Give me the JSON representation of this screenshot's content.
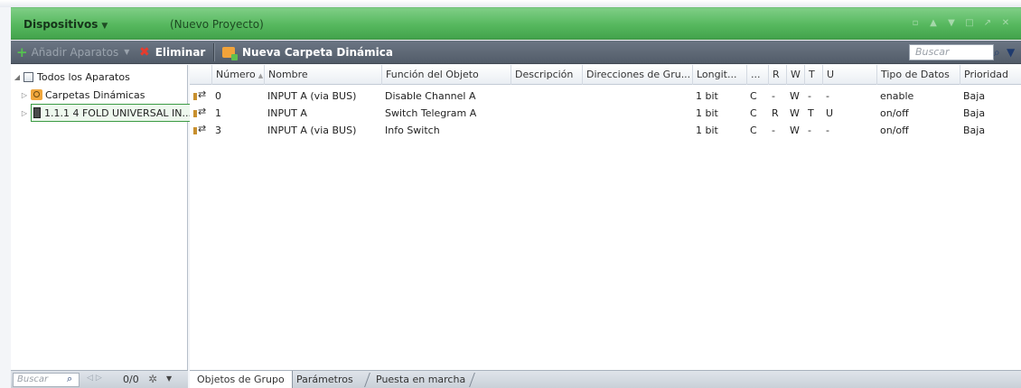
{
  "panel": {
    "title": "Dispositivos",
    "title_arrow": "▼",
    "project": "(Nuevo Proyecto)"
  },
  "toolbar": {
    "add_label": "Añadir Aparatos",
    "delete_label": "Eliminar",
    "new_folder_label": "Nueva Carpeta Dinámica",
    "search_placeholder": "Buscar"
  },
  "tree": {
    "items": [
      {
        "label": "Todos los Aparatos"
      },
      {
        "label": "Carpetas Dinámicas"
      },
      {
        "label": "1.1.1  4 FOLD UNIVERSAL IN..."
      }
    ],
    "footer": {
      "search_placeholder": "Buscar",
      "count": "0/0"
    }
  },
  "grid": {
    "columns": [
      "Número",
      "Nombre",
      "Función del Objeto",
      "Descripción",
      "Direcciones de Gru...",
      "Longit...",
      "...",
      "R",
      "W",
      "T",
      "U",
      "Tipo de Datos",
      "Prioridad"
    ],
    "rows": [
      {
        "num": "0",
        "name": "INPUT A (via BUS)",
        "func": "Disable Channel A",
        "desc": "",
        "addr": "",
        "len": "1 bit",
        "c": "C",
        "r": "-",
        "w": "W",
        "t": "-",
        "u": "-",
        "type": "enable",
        "prio": "Baja"
      },
      {
        "num": "1",
        "name": "INPUT A",
        "func": "Switch Telegram A",
        "desc": "",
        "addr": "",
        "len": "1 bit",
        "c": "C",
        "r": "R",
        "w": "W",
        "t": "T",
        "u": "U",
        "type": "on/off",
        "prio": "Baja"
      },
      {
        "num": "3",
        "name": "INPUT A (via BUS)",
        "func": "Info Switch",
        "desc": "",
        "addr": "",
        "len": "1 bit",
        "c": "C",
        "r": "-",
        "w": "W",
        "t": "-",
        "u": "-",
        "type": "on/off",
        "prio": "Baja"
      }
    ]
  },
  "tabs": [
    "Objetos de Grupo",
    "Parámetros",
    "Puesta en marcha"
  ],
  "colors": {
    "title_bar": "#56b85e",
    "toolbar": "#5f6976",
    "selection_border": "#3a9a42",
    "delete_icon": "#e63c2e"
  }
}
